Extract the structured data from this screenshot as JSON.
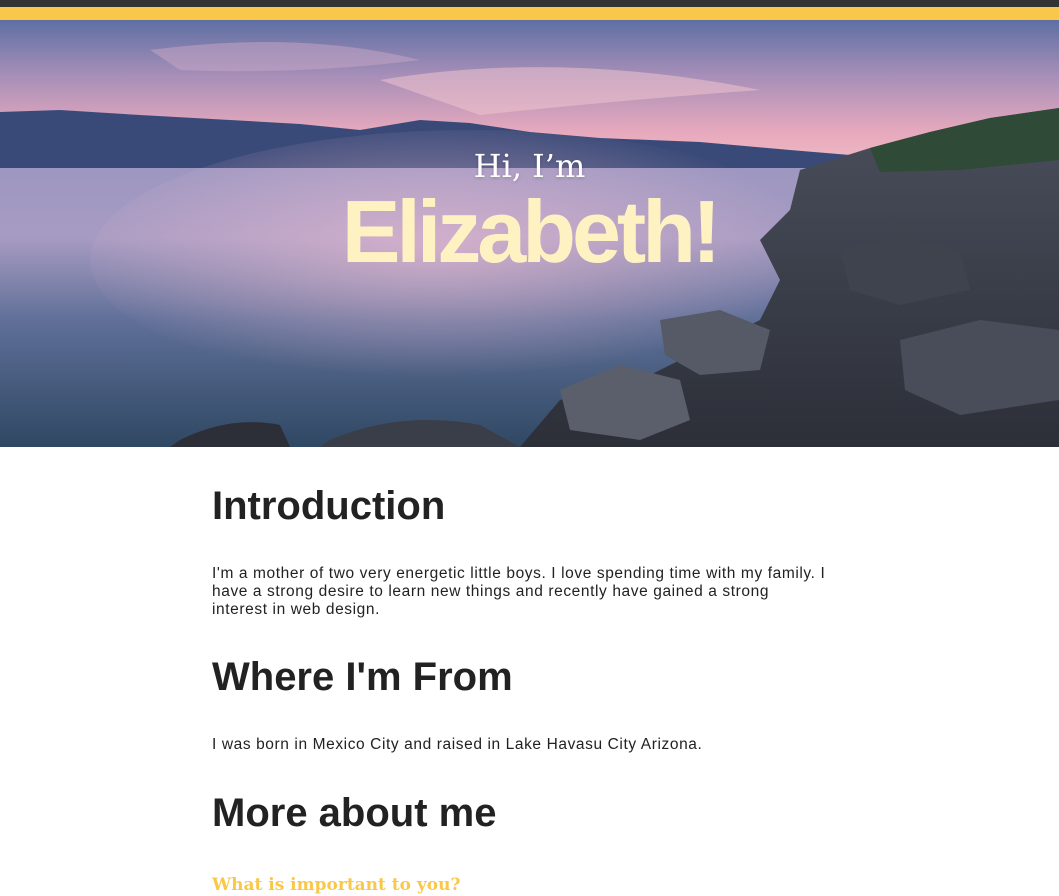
{
  "colors": {
    "top_bar": "#333333",
    "accent": "#f9c84a",
    "hero_name": "#fff2c2",
    "heading_text": "#222222"
  },
  "hero": {
    "image": "landscape-lake-sunset-rocks",
    "greeting": "Hi, I’m",
    "name": "Elizabeth!"
  },
  "sections": [
    {
      "heading": "Introduction",
      "text": "I'm a mother of two very energetic little boys. I love spending time with my family. I have a strong desire to learn new things and recently have gained a strong interest in web design."
    },
    {
      "heading": "Where I'm From",
      "text": "I was born in Mexico City and raised in Lake Havasu City Arizona."
    },
    {
      "heading": "More about me",
      "subheading": "What is important to you?"
    }
  ]
}
